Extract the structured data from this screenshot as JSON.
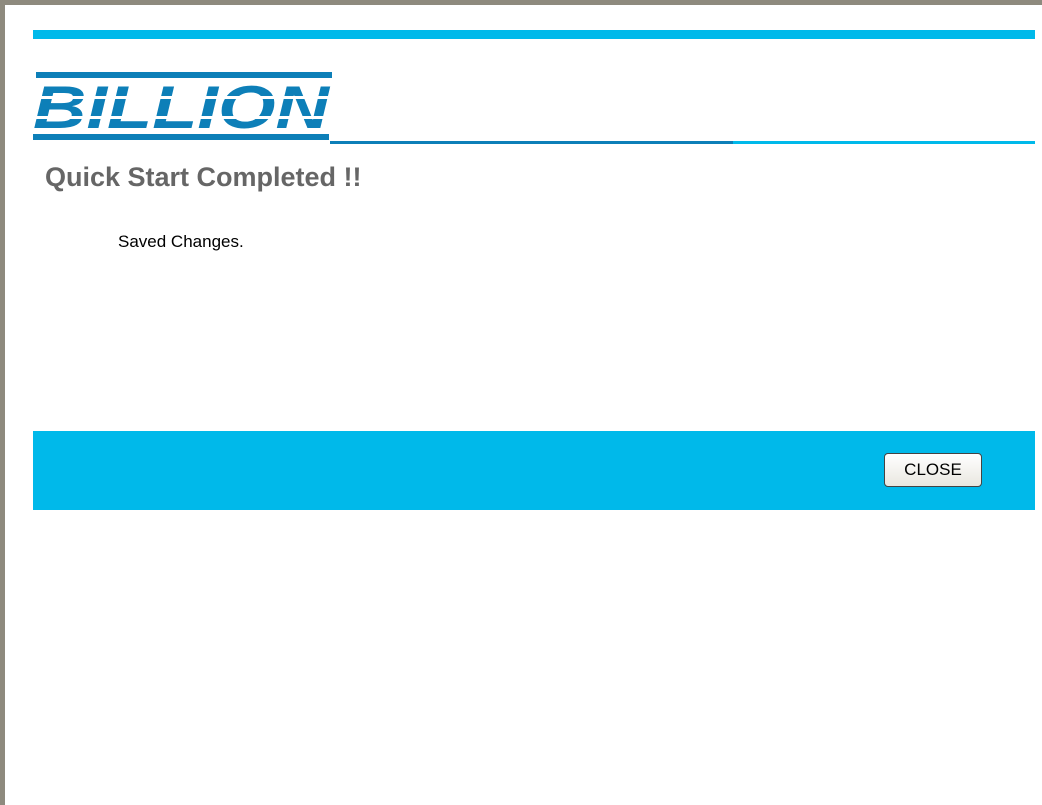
{
  "brand": {
    "logo_text": "BILLION",
    "accent_color": "#00b9ea",
    "logo_color": "#0d7fb8"
  },
  "page": {
    "title": "Quick Start Completed !!",
    "message": "Saved Changes."
  },
  "actions": {
    "close_label": "CLOSE"
  }
}
